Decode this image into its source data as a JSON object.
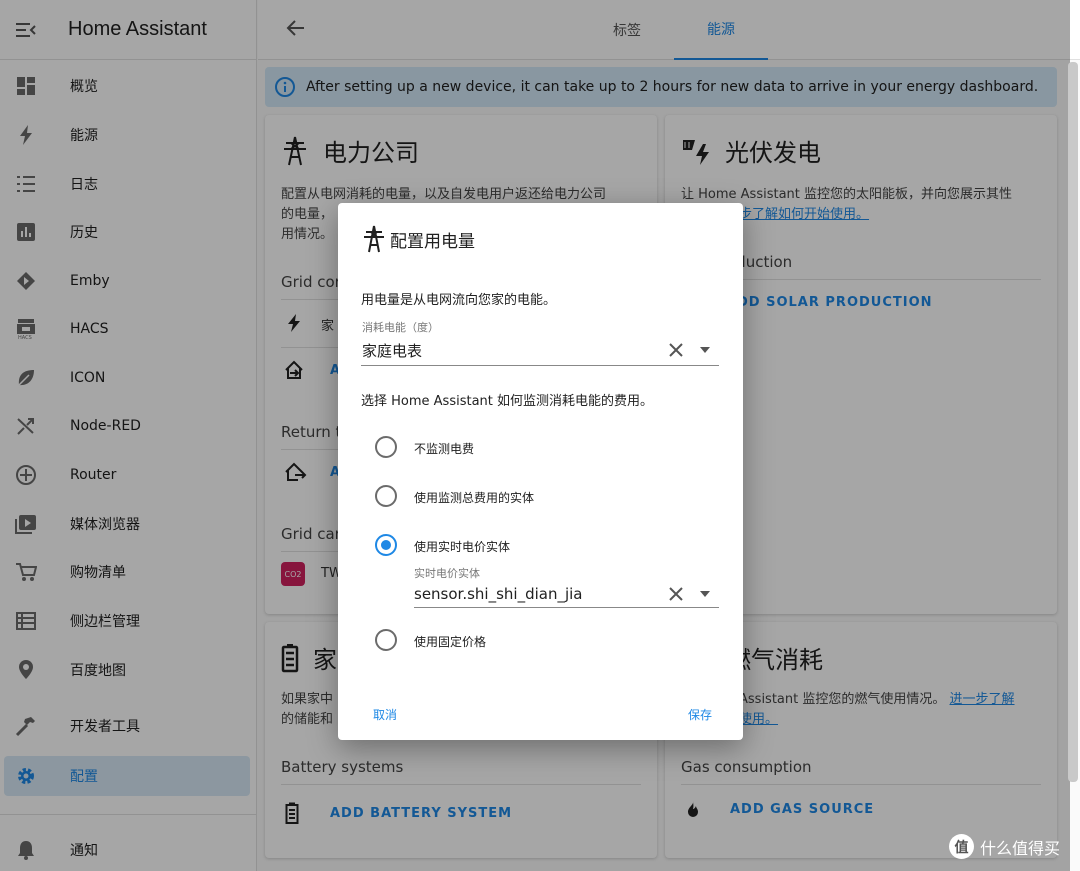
{
  "app": {
    "title": "Home Assistant"
  },
  "sidebar": {
    "items": [
      {
        "label": "概览",
        "icon": "dashboard-icon"
      },
      {
        "label": "能源",
        "icon": "lightning-icon"
      },
      {
        "label": "日志",
        "icon": "list-icon"
      },
      {
        "label": "历史",
        "icon": "chart-icon"
      },
      {
        "label": "Emby",
        "icon": "emby-icon"
      },
      {
        "label": "HACS",
        "icon": "hacs-icon"
      },
      {
        "label": "ICON",
        "icon": "leaf-icon"
      },
      {
        "label": "Node-RED",
        "icon": "shuffle-icon"
      },
      {
        "label": "Router",
        "icon": "router-icon"
      },
      {
        "label": "媒体浏览器",
        "icon": "play-box-icon"
      },
      {
        "label": "购物清单",
        "icon": "cart-icon"
      },
      {
        "label": "侧边栏管理",
        "icon": "table-icon"
      },
      {
        "label": "百度地图",
        "icon": "map-marker-icon"
      },
      {
        "label": "开发者工具",
        "icon": "hammer-icon"
      },
      {
        "label": "配置",
        "icon": "gear-icon"
      },
      {
        "label": "通知",
        "icon": "bell-icon"
      }
    ],
    "active_label": "配置"
  },
  "header": {
    "tabs": [
      {
        "label": "标签"
      },
      {
        "label": "能源"
      }
    ],
    "active_tab": "能源"
  },
  "banner": {
    "text": "After setting up a new device, it can take up to 2 hours for new data to arrive in your energy dashboard."
  },
  "cards": {
    "grid": {
      "title": "电力公司",
      "desc_line1": "配置从电网消耗的电量，以及自发电用户返还给电力公司",
      "desc_line2": "的电量，",
      "desc_line3": "用情况。",
      "grid_consumption": "Grid cor",
      "grid_item": "家",
      "add_short": "A",
      "return_to_grid": "Return t",
      "grid_carbon": "Grid car",
      "carbon_item": "TW",
      "carbon_badge": "CO2"
    },
    "solar": {
      "title": "光伏发电",
      "desc_line1": "让 Home Assistant 监控您的太阳能板，并向您展示其性",
      "desc_link": "步了解如何开始使用。",
      "solar_production": "oduction",
      "add_solar": "DD SOLAR PRODUCTION"
    },
    "battery": {
      "title": "家",
      "desc_line1": "如果家中",
      "desc_line2": "的储能和",
      "section": "Battery systems",
      "add": "ADD BATTERY SYSTEM"
    },
    "gas": {
      "title": "燃气消耗",
      "desc_line1": "Assistant 监控您的燃气使用情况。",
      "desc_link1": "进一步了解",
      "desc_link2": "使用。",
      "section": "Gas consumption",
      "add": "ADD GAS SOURCE"
    }
  },
  "dialog": {
    "title": "配置用电量",
    "intro": "用电量是从电网流向您家的电能。",
    "energy_field": {
      "label": "消耗电能（度）",
      "value": "家庭电表"
    },
    "cost_question": "选择 Home Assistant 如何监测消耗电能的费用。",
    "options": [
      {
        "label": "不监测电费",
        "selected": false
      },
      {
        "label": "使用监测总费用的实体",
        "selected": false
      },
      {
        "label": "使用实时电价实体",
        "selected": true
      },
      {
        "label": "使用固定价格",
        "selected": false
      }
    ],
    "price_field": {
      "label": "实时电价实体",
      "value": "sensor.shi_shi_dian_jia"
    },
    "cancel_label": "取消",
    "save_label": "保存"
  },
  "watermark": {
    "text": "什么值得买",
    "logo": "值"
  },
  "colors": {
    "accent": "#1e88e5",
    "banner_bg": "#d3e8f7",
    "active_bg": "#d7e9f6"
  }
}
